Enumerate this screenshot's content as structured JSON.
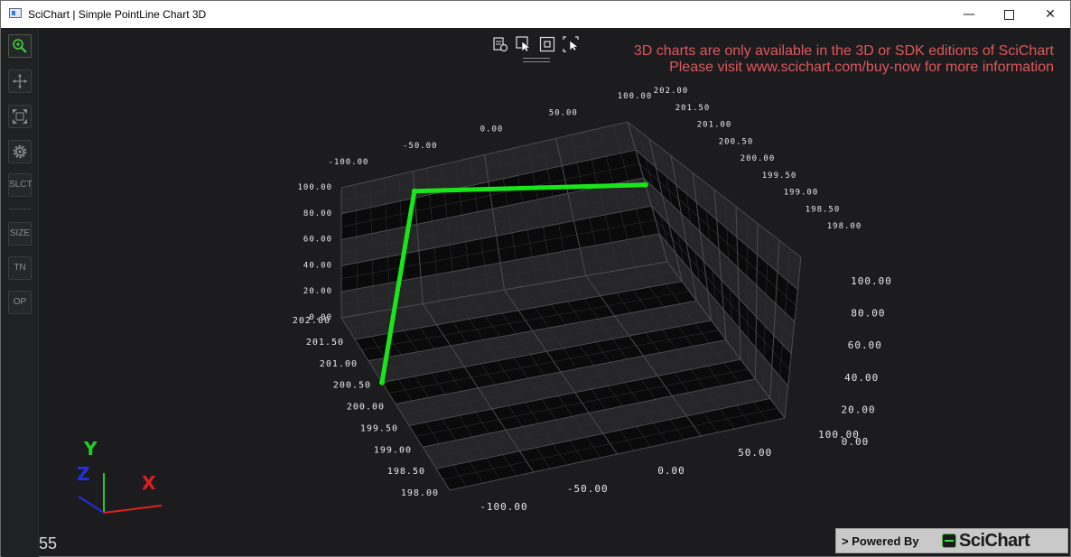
{
  "window": {
    "title": "SciChart | Simple PointLine Chart 3D",
    "controls": {
      "minimize": "—",
      "maximize": "",
      "close": "✕"
    }
  },
  "toolbar": {
    "items": [
      {
        "name": "zoom-icon",
        "label": ""
      },
      {
        "name": "pan-icon",
        "label": ""
      },
      {
        "name": "zoom-extents-icon",
        "label": ""
      },
      {
        "name": "settings-icon",
        "label": ""
      },
      {
        "name": "select-button",
        "label": "SLCT"
      },
      {
        "name": "size-button",
        "label": "SIZE"
      },
      {
        "name": "tn-button",
        "label": "TN"
      },
      {
        "name": "op-button",
        "label": "OP"
      }
    ]
  },
  "top_tools": [
    "export-icon",
    "select-cursor-icon",
    "fit-icon",
    "cursor-modifier-icon"
  ],
  "watermark": {
    "line1": "3D charts are only available in the 3D or SDK editions of SciChart",
    "line2": "Please visit www.scichart.com/buy-now for more information"
  },
  "fps": "55",
  "gizmo": {
    "x": "X",
    "y": "Y",
    "z": "Z"
  },
  "powered_by": {
    "prefix": "> Powered By",
    "brand": "SciChart"
  },
  "colors": {
    "series": "#19e619",
    "watermark": "#e0575c",
    "axis_x": "#e02020",
    "axis_y": "#20d020",
    "axis_z": "#2030e0",
    "background": "#1c1c1e"
  },
  "chart_data": {
    "type": "line",
    "dimensions": 3,
    "x_axis": {
      "ticks": [
        "-100.00",
        "-50.00",
        "0.00",
        "50.00",
        "100.00"
      ],
      "range": [
        -100,
        100
      ]
    },
    "y_axis": {
      "ticks": [
        "0.00",
        "20.00",
        "40.00",
        "60.00",
        "80.00",
        "100.00"
      ],
      "range": [
        0,
        100
      ]
    },
    "z_axis": {
      "ticks": [
        "198.00",
        "198.50",
        "199.00",
        "199.50",
        "200.00",
        "200.50",
        "201.00",
        "201.50",
        "202.00"
      ],
      "range": [
        198,
        202
      ]
    },
    "series": [
      {
        "color": "#19e619",
        "points": [
          {
            "x": -100,
            "y": 0,
            "z": 200.5
          },
          {
            "x": -50,
            "y": 85,
            "z": 202.0
          },
          {
            "x": 100,
            "y": 55,
            "z": 202.0
          }
        ]
      }
    ],
    "grid": true
  }
}
